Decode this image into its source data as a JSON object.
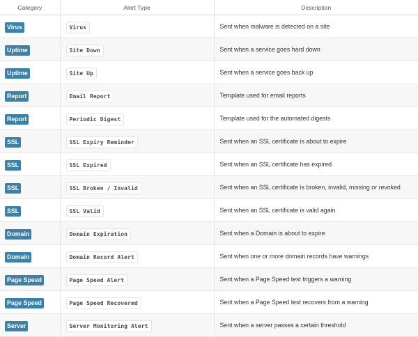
{
  "table": {
    "headers": [
      "Category",
      "Alert Type",
      "Description"
    ],
    "rows": [
      {
        "category": "Virus",
        "alert_type": "Virus",
        "description": "Sent when malware is detected on a site"
      },
      {
        "category": "Uptime",
        "alert_type": "Site Down",
        "description": "Sent when a service goes hard down"
      },
      {
        "category": "Uptime",
        "alert_type": "Site Up",
        "description": "Sent when a service goes back up"
      },
      {
        "category": "Report",
        "alert_type": "Email Report",
        "description": "Template used for email reports"
      },
      {
        "category": "Report",
        "alert_type": "Periodic Digest",
        "description": "Template used for the automated digests"
      },
      {
        "category": "SSL",
        "alert_type": "SSL Expiry Reminder",
        "description": "Sent when an SSL certificate is about to expire"
      },
      {
        "category": "SSL",
        "alert_type": "SSL Expired",
        "description": "Sent when an SSL certificate has expired"
      },
      {
        "category": "SSL",
        "alert_type": "SSL Broken / Invalid",
        "description": "Sent when an SSL certificate is broken, invalid, missing or revoked"
      },
      {
        "category": "SSL",
        "alert_type": "SSL Valid",
        "description": "Sent when an SSL certificate is valid again"
      },
      {
        "category": "Domain",
        "alert_type": "Domain Expiration",
        "description": "Sent when a Domain is about to expire"
      },
      {
        "category": "Domain",
        "alert_type": "Domain Record Alert",
        "description": "Sent when one or more domain records have warnings"
      },
      {
        "category": "Page Speed",
        "alert_type": "Page Speed Alert",
        "description": "Sent when a Page Speed test triggers a warning"
      },
      {
        "category": "Page Speed",
        "alert_type": "Page Speed Recovered",
        "description": "Sent when a Page Speed test recovers from a warning"
      },
      {
        "category": "Server",
        "alert_type": "Server Monitoring Alert",
        "description": "Sent when a server passes a certain threshold"
      }
    ]
  },
  "colors": {
    "badge": "#3a81ac",
    "stripe": "#f7f7f7"
  }
}
